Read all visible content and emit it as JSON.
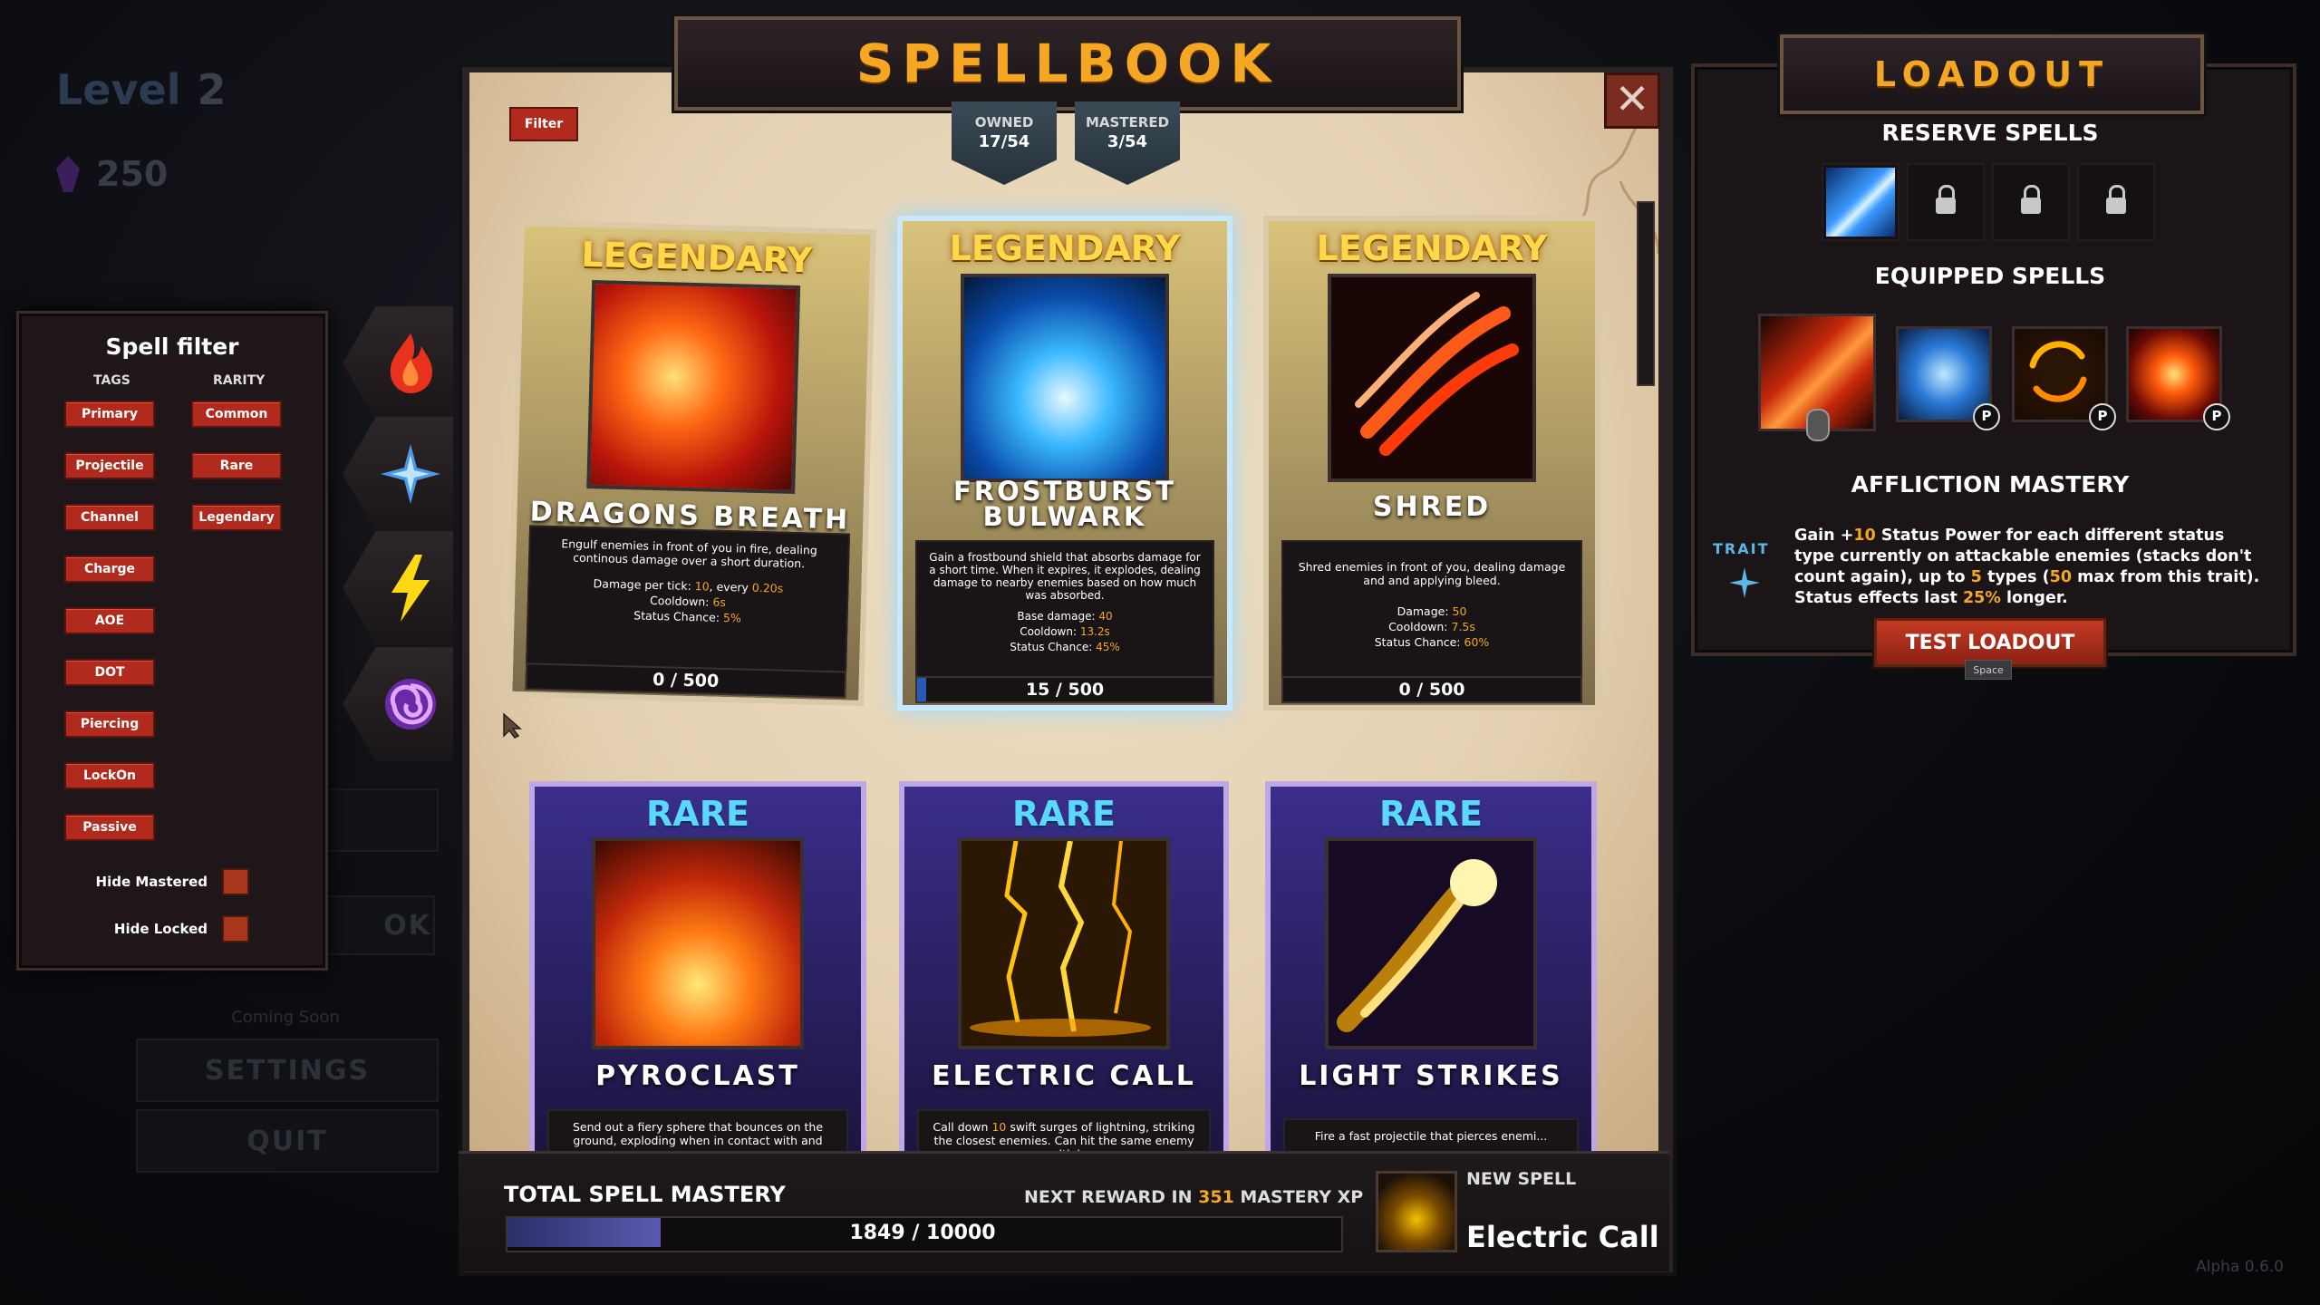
{
  "background": {
    "level_label": "Level",
    "level_value": "2",
    "gems": "250",
    "menu_ok_fragment": "OK",
    "coming_soon": "Coming Soon",
    "settings": "SETTINGS",
    "quit": "QUIT",
    "version": "Alpha  0.6.0"
  },
  "filter": {
    "title": "Spell filter",
    "tags_header": "TAGS",
    "rarity_header": "RARITY",
    "tags": [
      "Primary",
      "Projectile",
      "Channel",
      "Charge",
      "AOE",
      "DOT",
      "Piercing",
      "LockOn",
      "Passive"
    ],
    "rarities": [
      "Common",
      "Rare",
      "Legendary"
    ],
    "hide_mastered": "Hide Mastered",
    "hide_locked": "Hide Locked"
  },
  "categories": [
    "fire-icon",
    "frost-icon",
    "lightning-icon",
    "arcane-swirl-icon"
  ],
  "spellbook": {
    "title": "SPELLBOOK",
    "filter_button": "Filter",
    "close_symbol": "✕",
    "owned_label": "OWNED",
    "owned_value": "17/54",
    "mastered_label": "MASTERED",
    "mastered_value": "3/54"
  },
  "cards": [
    {
      "rarity": "LEGENDARY",
      "name": "DRAGONS BREATH",
      "desc": "Engulf enemies in front of you in fire, dealing continous damage over a short duration.",
      "stat1_label": "Damage per tick: ",
      "stat1_value": "10",
      "stat1_extra_label": ", every ",
      "stat1_extra_value": "0.20s",
      "stat2_label": "Cooldown: ",
      "stat2_value": "6s",
      "stat3_label": "Status Chance: ",
      "stat3_value": "5%",
      "progress": "0 / 500"
    },
    {
      "rarity": "LEGENDARY",
      "name_line1": "FROSTBURST",
      "name_line2": "BULWARK",
      "desc": "Gain a frostbound shield that absorbs damage for a short time. When it expires, it explodes, dealing damage to nearby enemies based on how much was absorbed.",
      "stat1_label": "Base damage: ",
      "stat1_value": "40",
      "stat2_label": "Cooldown: ",
      "stat2_value": "13.2s",
      "stat3_label": "Status Chance: ",
      "stat3_value": "45%",
      "progress": "15 / 500"
    },
    {
      "rarity": "LEGENDARY",
      "name": "SHRED",
      "desc": "Shred enemies in front of you, dealing damage and and applying bleed.",
      "stat1_label": "Damage: ",
      "stat1_value": "50",
      "stat2_label": "Cooldown: ",
      "stat2_value": "7.5s",
      "stat3_label": "Status Chance: ",
      "stat3_value": "60%",
      "progress": "0 / 500"
    },
    {
      "rarity": "RARE",
      "name": "PYROCLAST",
      "desc": "Send out a fiery sphere that bounces on the ground, exploding when in contact with and enemy"
    },
    {
      "rarity": "RARE",
      "name": "ELECTRIC CALL",
      "desc_pre": "Call down ",
      "desc_hi": "10",
      "desc_post": " swift surges of lightning, striking the closest enemies. Can hit the same enemy multiple"
    },
    {
      "rarity": "RARE",
      "name": "LIGHT STRIKES",
      "desc": "Fire a fast projectile that pierces enemi..."
    }
  ],
  "mastery": {
    "title": "TOTAL SPELL MASTERY",
    "next_pre": "NEXT REWARD IN ",
    "next_value": "351",
    "next_post": " MASTERY XP",
    "progress": "1849 / 10000",
    "progress_fraction": 0.1849,
    "new_spell_label": "NEW SPELL",
    "new_spell_name": "Electric Call"
  },
  "loadout": {
    "title": "LOADOUT",
    "reserve_title": "RESERVE SPELLS",
    "equipped_title": "EQUIPPED SPELLS",
    "passive_badge": "P",
    "affliction_title": "AFFLICTION MASTERY",
    "trait_label": "TRAIT",
    "trait_parts": [
      "Gain +",
      "10",
      " Status Power for each different status type currently on attackable enemies (stacks don't count again), up to ",
      "5",
      " types (",
      "50",
      " max from this trait). Status effects last ",
      "25%",
      " longer."
    ],
    "test_button": "TEST LOADOUT",
    "test_key": "Space"
  },
  "colors": {
    "accent_gold": "#f5a623",
    "button_red": "#b02a1e",
    "rare_blue": "#5ad8ff",
    "legendary_yellow": "#ffd84a"
  }
}
